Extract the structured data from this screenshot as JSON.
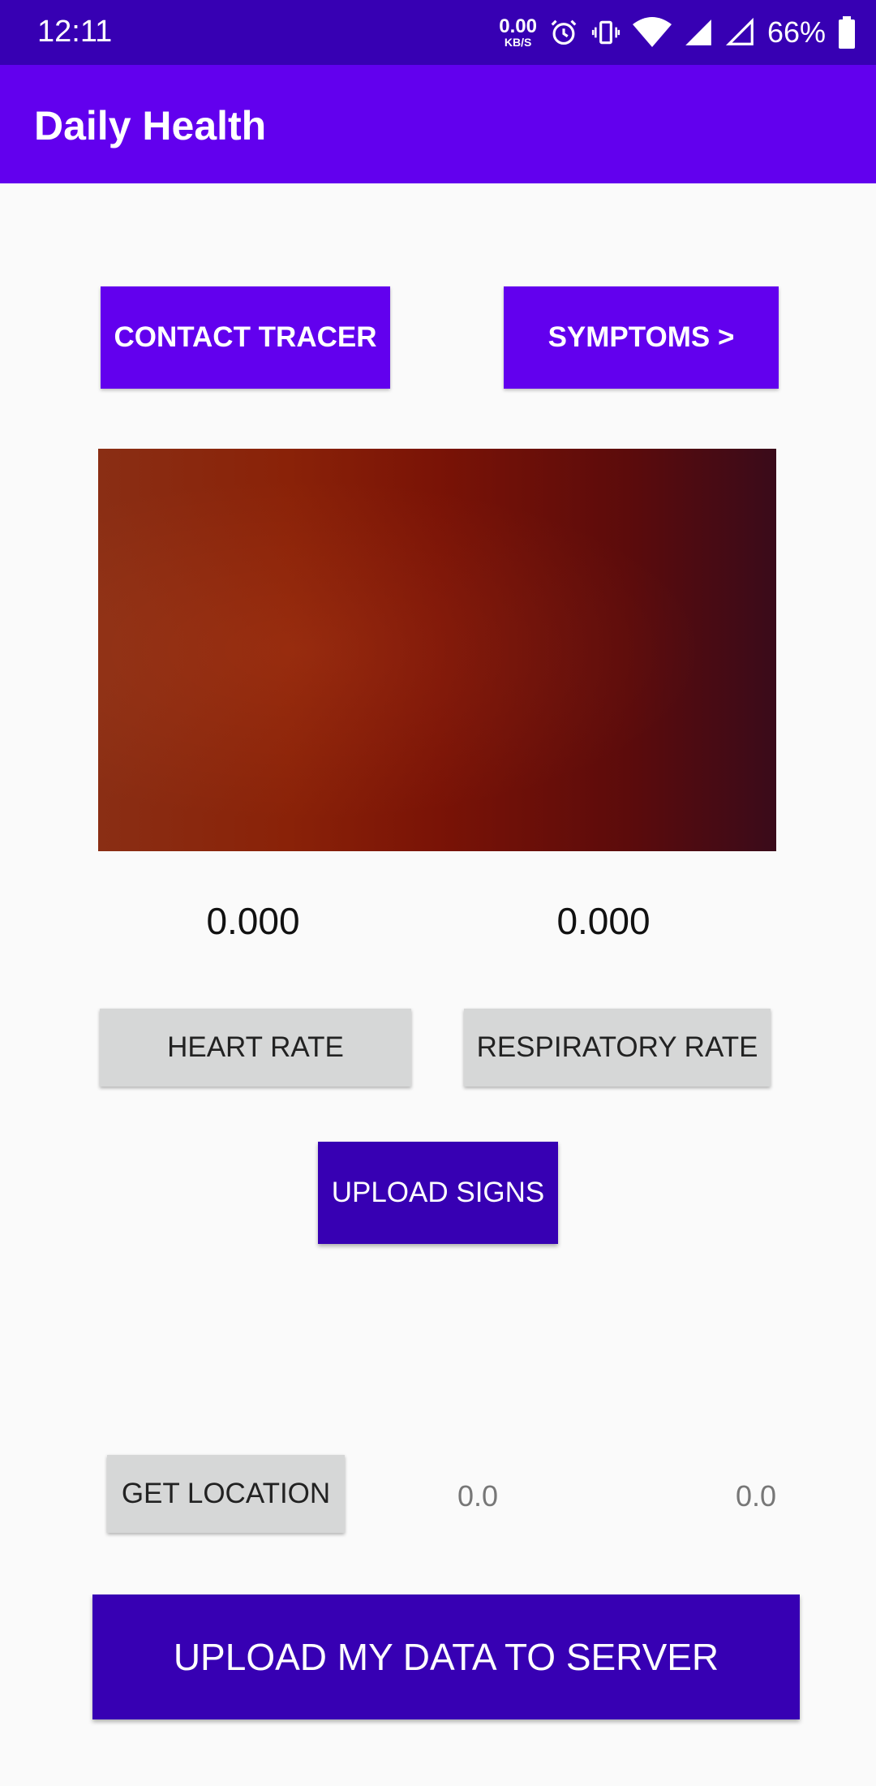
{
  "status_bar": {
    "time": "12:11",
    "net_speed_value": "0.00",
    "net_speed_unit": "KB/S",
    "battery_percent": "66%"
  },
  "app_bar": {
    "title": "Daily Health"
  },
  "top_buttons": {
    "contact_tracer": "CONTACT TRACER",
    "symptoms": "SYMPTOMS >"
  },
  "readings": {
    "heart_rate_value": "0.000",
    "respiratory_rate_value": "0.000"
  },
  "measure_buttons": {
    "heart_rate": "HEART RATE",
    "respiratory_rate": "RESPIRATORY RATE"
  },
  "upload_signs": "UPLOAD SIGNS",
  "location": {
    "button": "GET LOCATION",
    "latitude": "0.0",
    "longitude": "0.0"
  },
  "upload_all": "UPLOAD MY DATA TO SERVER",
  "colors": {
    "primary": "#6200ee",
    "primary_dark": "#3700b3",
    "gray_button": "#d6d7d7",
    "background": "#fafafa"
  }
}
